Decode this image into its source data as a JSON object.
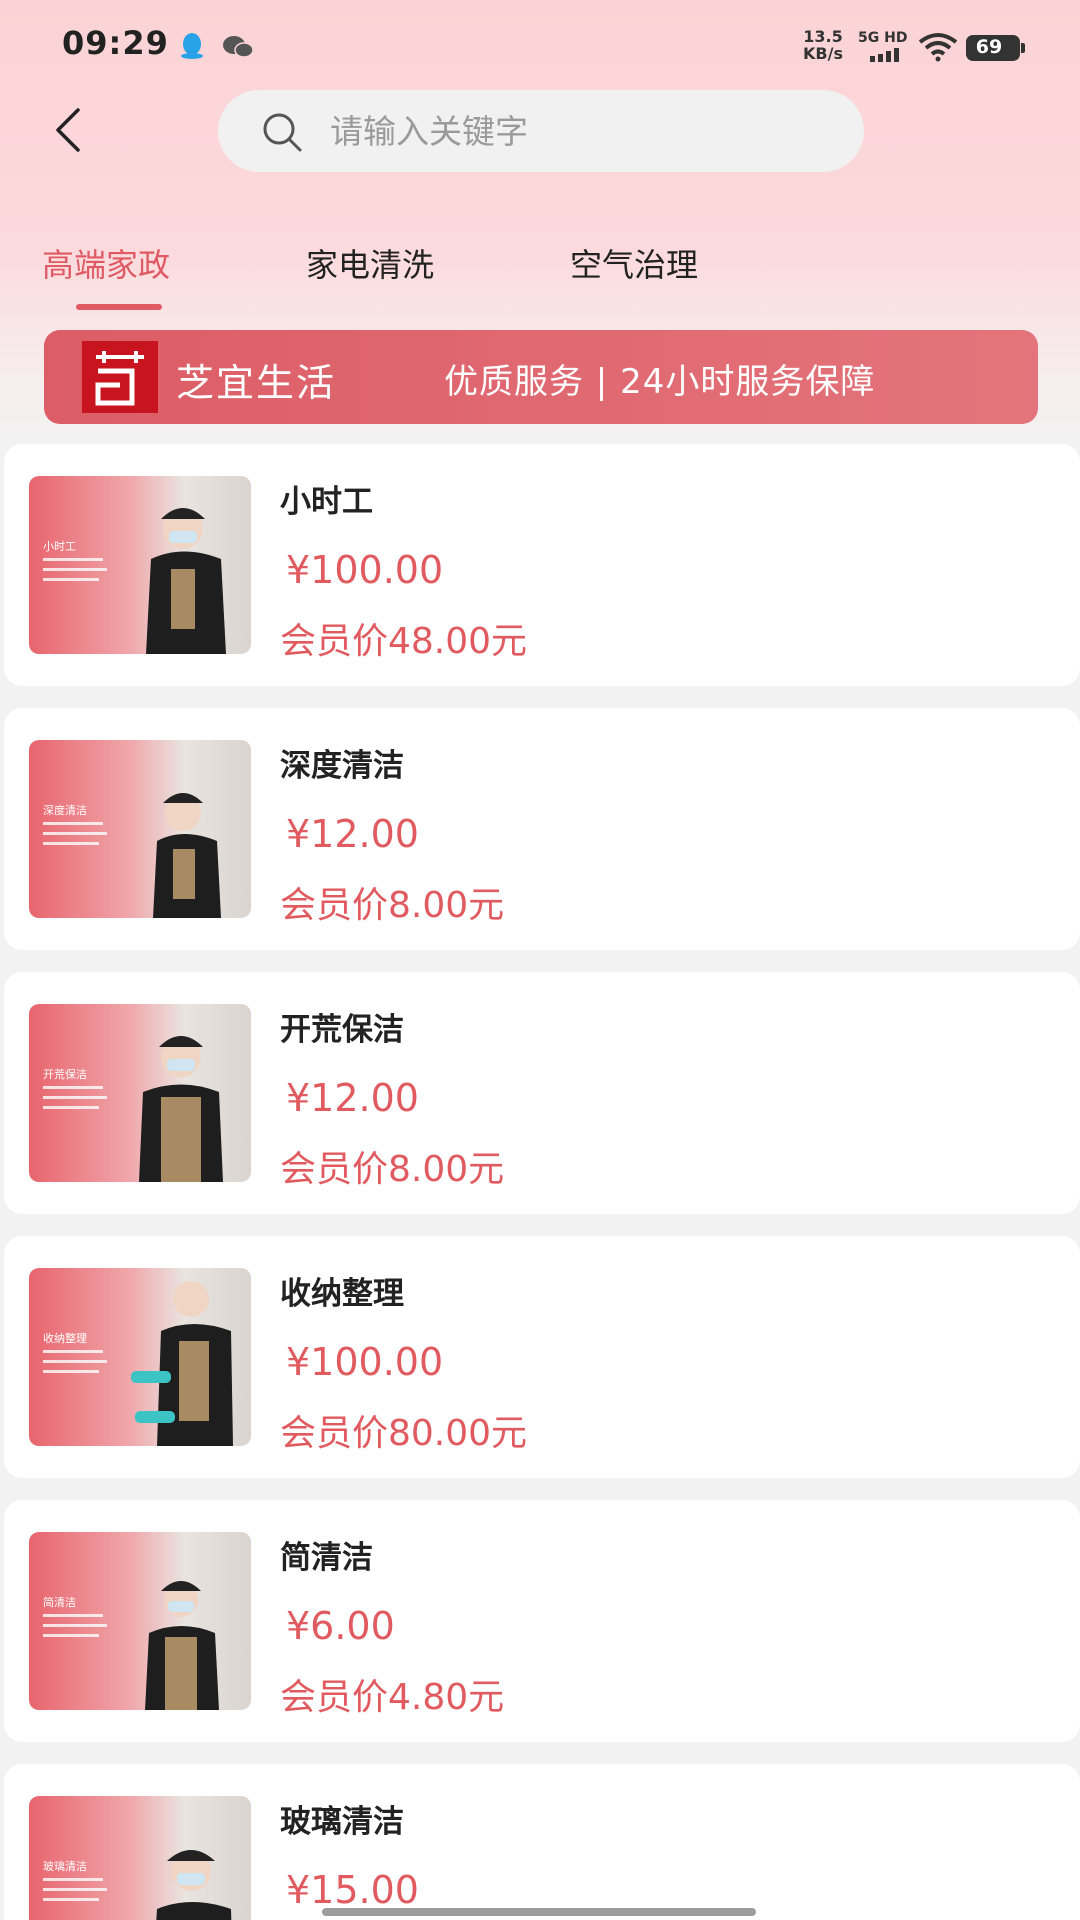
{
  "status_bar": {
    "time": "09:29",
    "net_speed_value": "13.5",
    "net_speed_unit": "KB/s",
    "signal_label": "5G HD",
    "battery": "69"
  },
  "header": {
    "search_placeholder": "请输入关键字"
  },
  "tabs": [
    {
      "label": "高端家政",
      "active": true
    },
    {
      "label": "家电清洗",
      "active": false
    },
    {
      "label": "空气治理",
      "active": false
    }
  ],
  "banner": {
    "brand": "芝宜生活",
    "slogan": "优质服务 | 24小时服务保障"
  },
  "items": [
    {
      "name": "小时工",
      "price": "¥100.00",
      "member_price": "会员价48.00元"
    },
    {
      "name": "深度清洁",
      "price": "¥12.00",
      "member_price": "会员价8.00元"
    },
    {
      "name": "开荒保洁",
      "price": "¥12.00",
      "member_price": "会员价8.00元"
    },
    {
      "name": "收纳整理",
      "price": "¥100.00",
      "member_price": "会员价80.00元"
    },
    {
      "name": "简清洁",
      "price": "¥6.00",
      "member_price": "会员价4.80元"
    },
    {
      "name": "玻璃清洁",
      "price": "¥15.00",
      "member_price": ""
    }
  ],
  "colors": {
    "accent": "#e05a63",
    "header_bg": "#fbd3d6",
    "banner_bg": "#dc5d66"
  }
}
